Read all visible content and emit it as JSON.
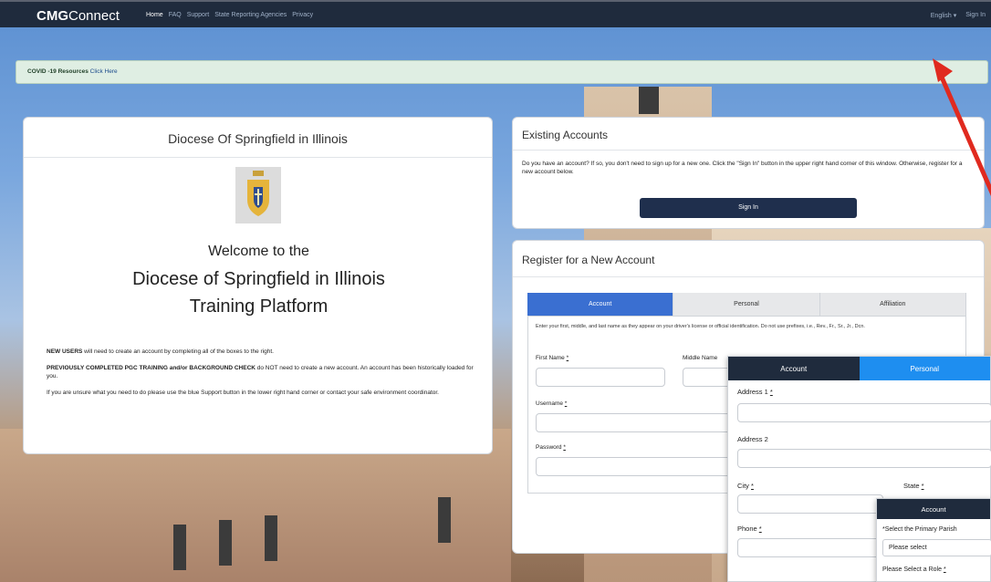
{
  "nav": {
    "brand_bold": "CMG",
    "brand_rest": "Connect",
    "links": [
      "Home",
      "FAQ",
      "Support",
      "State Reporting Agencies",
      "Privacy"
    ],
    "language": "English",
    "sign_in": "Sign In"
  },
  "covid": {
    "label": "COVID -19 Resources",
    "link": "Click Here"
  },
  "diocese": {
    "header": "Diocese Of Springfield in Illinois",
    "welcome_line1": "Welcome to the",
    "welcome_line2": "Diocese of Springfield in Illinois",
    "welcome_line3": "Training Platform",
    "p1_bold": "NEW USERS",
    "p1_rest": " will need to create an account by completing all of the boxes to the right.",
    "p2_bold": "PREVIOUSLY COMPLETED PGC TRAINING and/or BACKGROUND CHECK",
    "p2_rest": " do NOT need to create a new account.  An account has been historically loaded for you.",
    "p3": "If you are unsure what you need to do please use the blue Support button in the lower right hand corner or contact your safe environment coordinator."
  },
  "existing": {
    "title": "Existing Accounts",
    "body": "Do you have an account? If so, you don't need to sign up for a new one. Click the \"Sign In\" button in the upper right hand corner of this window. Otherwise, register for a new account below.",
    "button": "Sign In"
  },
  "register": {
    "title": "Register for a New Account",
    "tabs": [
      "Account",
      "Personal",
      "Affiliation"
    ],
    "note": "Enter your first, middle, and last name as they appear on your driver's license or official identification. Do not use prefixes, i.e., Rev., Fr., Sr., Jr., Dcn.",
    "first_name": "First Name",
    "middle_name": "Middle Name",
    "username": "Username",
    "password": "Password",
    "req": "*"
  },
  "overlay_personal": {
    "tabs": [
      "Account",
      "Personal"
    ],
    "address1": "Address 1",
    "address2": "Address 2",
    "city": "City",
    "state": "State",
    "phone": "Phone",
    "req": "*"
  },
  "overlay_affiliation": {
    "tab": "Account",
    "parish_label": "*Select the Primary Parish",
    "parish_value": "Please select",
    "role_label": "Please Select a Role",
    "req": "*"
  },
  "colors": {
    "nav_bg": "#1f2b3d",
    "accent_blue": "#3a6fd1",
    "button_dark": "#1f2f4d",
    "arrow_red": "#e02a1f"
  }
}
